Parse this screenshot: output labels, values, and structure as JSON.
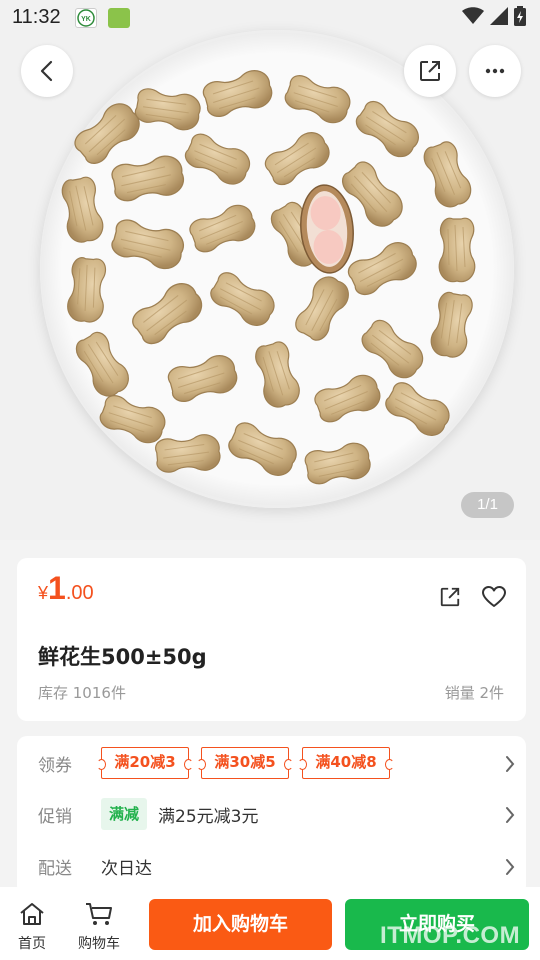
{
  "status_bar": {
    "time": "11:32",
    "icons": [
      "yk-app-badge",
      "green-app-badge",
      "wifi-icon",
      "signal-icon",
      "battery-charging-icon"
    ]
  },
  "header": {
    "back_icon": "chevron-left-icon",
    "share_icon": "share-icon",
    "more_icon": "more-dots-icon"
  },
  "gallery": {
    "image": "peanuts-in-bowl",
    "indicator": "1/1"
  },
  "product": {
    "currency": "¥",
    "price_int": "1",
    "price_dec": ".00",
    "title": "鲜花生500±50g",
    "stock": "库存 1016件",
    "sales": "销量 2件"
  },
  "promo": {
    "coupon_label": "领券",
    "coupons": [
      "满20减3",
      "满30减5",
      "满40减8"
    ],
    "promotion_label": "促销",
    "promotion_tag": "满减",
    "promotion_text": "满25元减3元",
    "delivery_label": "配送",
    "delivery_text": "次日达"
  },
  "bottom_bar": {
    "home_label": "首页",
    "cart_label": "购物车",
    "add_to_cart": "加入购物车",
    "buy_now": "立即购买"
  },
  "watermark": "ITMOP.COM",
  "colors": {
    "accent_orange": "#f4511e",
    "cart_button": "#fa5a14",
    "buy_button": "#19b94c",
    "promo_green": "#22b14c"
  }
}
